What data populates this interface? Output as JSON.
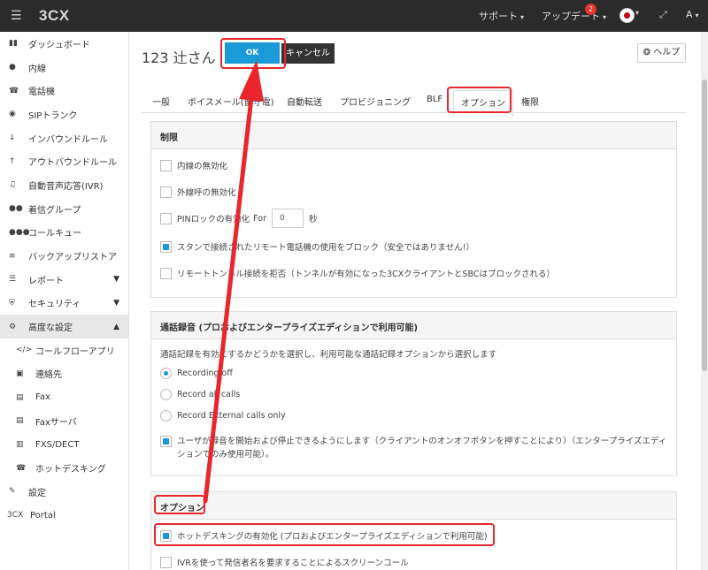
{
  "topbar": {
    "logo": "3CX",
    "support": "サポート",
    "updates": "アップデート",
    "update_count": "2",
    "user": "A"
  },
  "sidebar": {
    "items": [
      {
        "label": "ダッシュボード",
        "icon": "bar-chart-icon"
      },
      {
        "label": "内線",
        "icon": "user-icon"
      },
      {
        "label": "電話機",
        "icon": "phone-icon"
      },
      {
        "label": "SIPトランク",
        "icon": "globe-icon"
      },
      {
        "label": "インバウンドルール",
        "icon": "arrow-down-icon"
      },
      {
        "label": "アウトバウンドルール",
        "icon": "arrow-up-icon"
      },
      {
        "label": "自動音声応答(IVR)",
        "icon": "headset-icon"
      },
      {
        "label": "着信グループ",
        "icon": "group-icon"
      },
      {
        "label": "コールキュー",
        "icon": "queue-icon"
      },
      {
        "label": "バックアップリストア",
        "icon": "database-icon"
      },
      {
        "label": "レポート",
        "icon": "list-icon"
      },
      {
        "label": "セキュリティ",
        "icon": "shield-icon"
      },
      {
        "label": "高度な設定",
        "icon": "gear-icon"
      },
      {
        "label": "コールフローアプリ",
        "icon": "code-icon"
      },
      {
        "label": "連絡先",
        "icon": "contact-icon"
      },
      {
        "label": "Fax",
        "icon": "fax-icon"
      },
      {
        "label": "Faxサーバ",
        "icon": "fax-server-icon"
      },
      {
        "label": "FXS/DECT",
        "icon": "fxs-icon"
      },
      {
        "label": "ホットデスキング",
        "icon": "hotdesk-icon"
      },
      {
        "label": "設定",
        "icon": "wrench-icon"
      },
      {
        "label": "Portal",
        "icon": "3cx-portal-icon"
      }
    ],
    "portal_prefix": "3CX"
  },
  "header": {
    "title": "123 辻さん",
    "ok_label": "OK",
    "cancel_label": "キャンセル",
    "help_label": "ヘルプ"
  },
  "tabs": [
    "一般",
    "ボイスメール(留守電)",
    "自動転送",
    "プロビジョニング",
    "BLF",
    "オプション",
    "権限"
  ],
  "active_tab": "オプション",
  "restrictions": {
    "title": "制限",
    "disable_extension": "内線の無効化",
    "disable_outbound": "外線呼の無効化",
    "pin_lock": "PINロックの有効化",
    "pin_for": "For",
    "pin_value": "0",
    "pin_unit": "秒",
    "block_stun": "スタンで接続されたリモート電話機の使用をブロック（安全ではありません!）",
    "reject_tunnel": "リモートトンネル接続を拒否（トンネルが有効になった3CXクライアントとSBCはブロックされる）"
  },
  "recording": {
    "title": "通話録音 (プロおよびエンタープライズエディションで利用可能)",
    "description": "通話記録を有効にするかどうかを選択し、利用可能な通話記録オプションから選択します",
    "options": [
      "Recording off",
      "Record all calls",
      "Record External calls only"
    ],
    "selected": "Recording off",
    "user_control_line1": "ユーザが録音を開始および停止できるようにします（クライアントのオンオフボタンを押すことにより）（エンタープライズエディ",
    "user_control_line2": "ションでのみ使用可能）。"
  },
  "options": {
    "title": "オプション",
    "hotdesk": "ホットデスキングの有効化 (プロおよびエンタープライズエディションで利用可能)",
    "ivr_screen": "IVRを使って発信者名を要求することによるスクリーンコール"
  },
  "colors": {
    "accent": "#1a9ad6",
    "highlight": "#e8262c",
    "topbar": "#2b2b2b"
  }
}
